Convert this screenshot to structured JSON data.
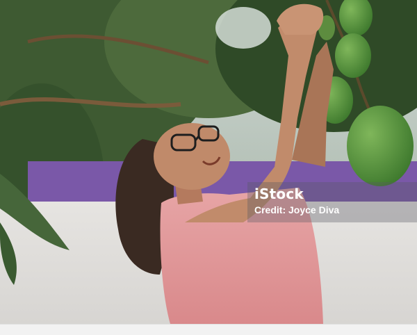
{
  "photo": {
    "subject": "photo",
    "watermark": {
      "brand": "iStock",
      "credit": "Credit: Joyce Diva"
    }
  }
}
